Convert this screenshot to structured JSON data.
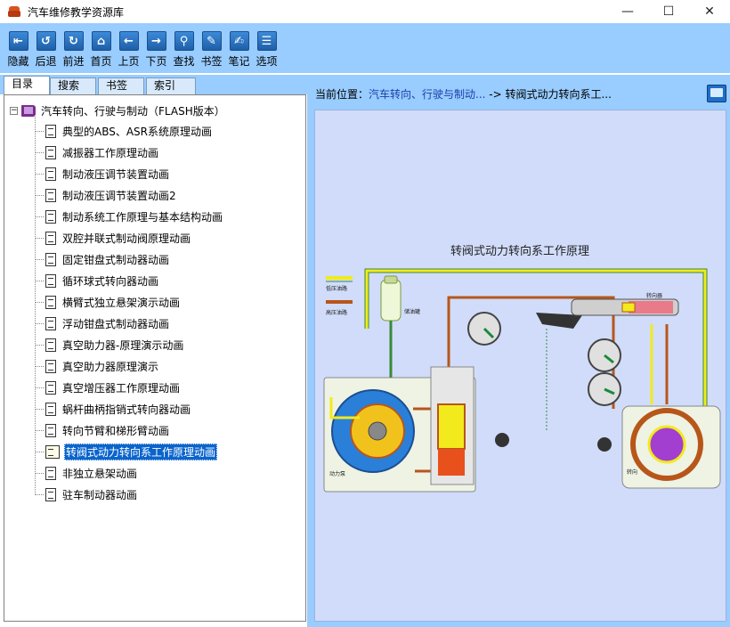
{
  "window": {
    "title": "汽车维修教学资源库",
    "minimize_glyph": "—",
    "maximize_glyph": "☐",
    "close_glyph": "✕"
  },
  "toolbar": {
    "buttons": [
      {
        "label": "隐藏",
        "icon": "hide-icon",
        "glyph": "⇤"
      },
      {
        "label": "后退",
        "icon": "back-icon",
        "glyph": "↺"
      },
      {
        "label": "前进",
        "icon": "forward-icon",
        "glyph": "↻"
      },
      {
        "label": "首页",
        "icon": "home-icon",
        "glyph": "⌂"
      },
      {
        "label": "上页",
        "icon": "prev-page-icon",
        "glyph": "←"
      },
      {
        "label": "下页",
        "icon": "next-page-icon",
        "glyph": "→"
      },
      {
        "label": "查找",
        "icon": "find-icon",
        "glyph": "⚲"
      },
      {
        "label": "书签",
        "icon": "bookmark-icon",
        "glyph": "✎"
      },
      {
        "label": "笔记",
        "icon": "notes-icon",
        "glyph": "✍"
      },
      {
        "label": "选项",
        "icon": "options-icon",
        "glyph": "☰"
      }
    ]
  },
  "tabs": [
    {
      "label": "目录",
      "active": true
    },
    {
      "label": "搜索",
      "active": false
    },
    {
      "label": "书签",
      "active": false
    },
    {
      "label": "索引",
      "active": false
    }
  ],
  "tree": {
    "root_expander": "⊟",
    "root_label": "汽车转向、行驶与制动（FLASH版本）",
    "items": [
      "典型的ABS、ASR系统原理动画",
      "减振器工作原理动画",
      "制动液压调节装置动画",
      "制动液压调节装置动画2",
      "制动系统工作原理与基本结构动画",
      "双腔并联式制动阀原理动画",
      "固定钳盘式制动器动画",
      "循环球式转向器动画",
      "横臂式独立悬架演示动画",
      "浮动钳盘式制动器动画",
      "真空助力器-原理演示动画",
      "真空助力器原理演示",
      "真空增压器工作原理动画",
      "蜗杆曲柄指销式转向器动画",
      "转向节臂和梯形臂动画",
      "转阀式动力转向系工作原理动画",
      "非独立悬架动画",
      "驻车制动器动画"
    ],
    "selected_index": 15
  },
  "location": {
    "label": "当前位置：",
    "path1": "汽车转向、行驶与制动...",
    "separator": " -> ",
    "path2": "转阀式动力转向系工..."
  },
  "diagram": {
    "title": "转阀式动力转向系工作原理",
    "legend_low": "低压油路",
    "legend_high": "高压油路",
    "label_reservoir": "储油罐",
    "label_pump": "动力泵",
    "label_steering_gear": "转向器",
    "label_steering_wheel": "转向",
    "colors": {
      "background": "#d0dcfa",
      "low_pressure": "#f2ea1c",
      "high_pressure": "#b8561a",
      "pump_blue": "#2a7fd9",
      "valve_red": "#e8501c",
      "gauge_needle": "#1a8a3a"
    }
  }
}
